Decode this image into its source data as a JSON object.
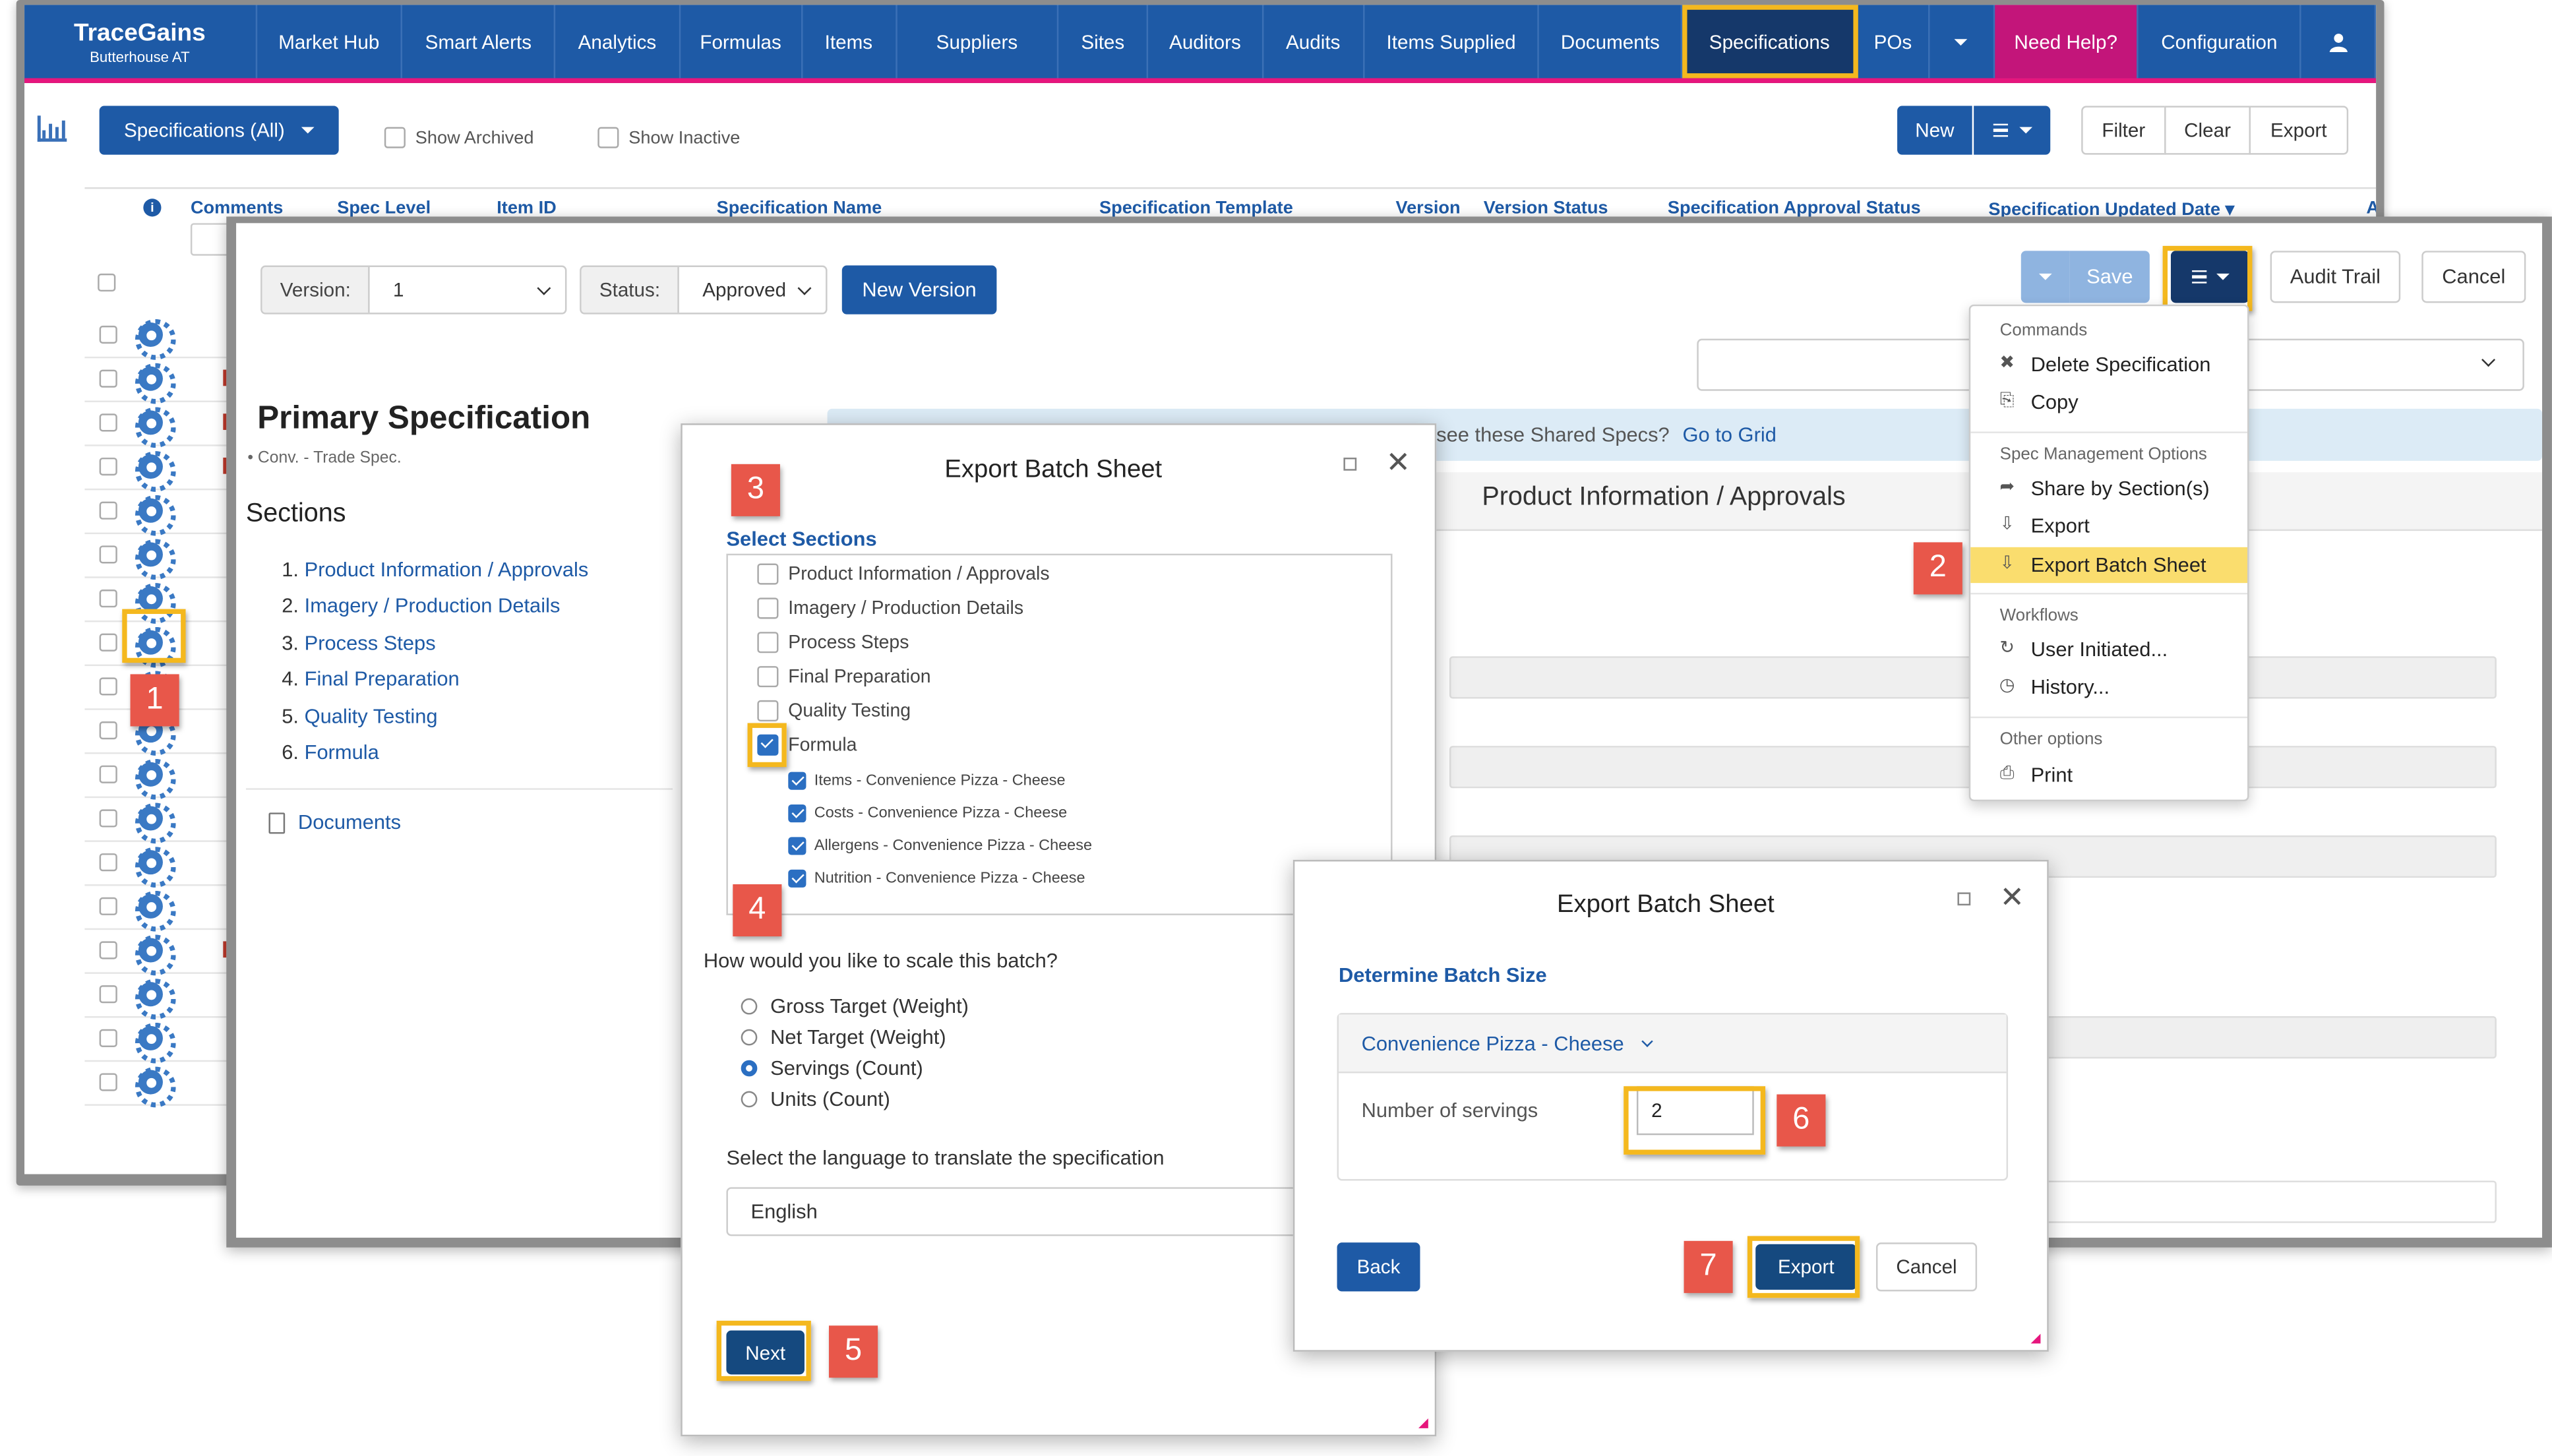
{
  "app": {
    "brand_name": "TraceGains",
    "brand_sub": "Butterhouse AT",
    "nav": [
      "Market Hub",
      "Smart Alerts",
      "Analytics",
      "Formulas",
      "Items",
      "Suppliers",
      "Sites",
      "Auditors",
      "Audits",
      "Items Supplied",
      "Documents",
      "Specifications",
      "POs"
    ],
    "help": "Need Help?",
    "config": "Configuration"
  },
  "list_toolbar": {
    "spec_filter": "Specifications (All)",
    "show_archived": "Show Archived",
    "show_inactive": "Show Inactive",
    "new_label": "New",
    "filter_label": "Filter",
    "clear_label": "Clear",
    "export_label": "Export"
  },
  "grid": {
    "columns": [
      "Comments",
      "Spec Level",
      "Item ID",
      "Specification Name",
      "Specification Template",
      "Version",
      "Version Status",
      "Specification Approval Status",
      "Specification Updated Date ▾",
      "A"
    ]
  },
  "spec_editor": {
    "version_label": "Version:",
    "version_value": "1",
    "status_label": "Status:",
    "status_value": "Approved",
    "new_version": "New Version",
    "save": "Save",
    "audit_trail": "Audit Trail",
    "cancel": "Cancel",
    "primary_title": "Primary Specification",
    "primary_sub": "• Conv. - Trade Spec.",
    "sections_heading": "Sections",
    "sections": [
      {
        "num": "1.",
        "label": "Product Information / Approvals"
      },
      {
        "num": "2.",
        "label": "Imagery / Production Details"
      },
      {
        "num": "3.",
        "label": "Process Steps"
      },
      {
        "num": "4.",
        "label": "Final Preparation"
      },
      {
        "num": "5.",
        "label": "Quality Testing"
      },
      {
        "num": "6.",
        "label": "Formula"
      }
    ],
    "documents": "Documents",
    "shared_banner_text": "see these Shared Specs?",
    "shared_banner_link": "Go to Grid",
    "panel_title": "Product Information / Approvals"
  },
  "dropdown_menu": {
    "commands_header": "Commands",
    "delete_spec": "Delete Specification",
    "copy": "Copy",
    "spec_mgmt_header": "Spec Management Options",
    "share_by_section": "Share by Section(s)",
    "export": "Export",
    "export_batch_sheet": "Export Batch Sheet",
    "workflows_header": "Workflows",
    "user_initiated": "User Initiated...",
    "history": "History...",
    "other_header": "Other options",
    "print": "Print"
  },
  "modal_select": {
    "title": "Export Batch Sheet",
    "select_sections": "Select Sections",
    "sections": [
      "Product Information / Approvals",
      "Imagery / Production Details",
      "Process Steps",
      "Final Preparation",
      "Quality Testing",
      "Formula"
    ],
    "sub_items": [
      "Items - Convenience Pizza - Cheese",
      "Costs - Convenience Pizza - Cheese",
      "Allergens - Convenience Pizza - Cheese",
      "Nutrition - Convenience Pizza - Cheese"
    ],
    "scale_question": "How would you like to scale this batch?",
    "scale_options": [
      "Gross Target (Weight)",
      "Net Target (Weight)",
      "Servings (Count)",
      "Units (Count)"
    ],
    "selected_scale": "Servings (Count)",
    "language_question": "Select the language to translate the specification",
    "language_value": "English",
    "next": "Next"
  },
  "modal_batch": {
    "title": "Export Batch Sheet",
    "determine_batch": "Determine Batch Size",
    "item_name": "Convenience Pizza - Cheese",
    "servings_label": "Number of servings",
    "servings_value": "2",
    "back": "Back",
    "export": "Export",
    "cancel": "Cancel"
  },
  "callouts": [
    "1",
    "2",
    "3",
    "4",
    "5",
    "6",
    "7"
  ],
  "colors": {
    "nav_blue": "#1e5aa6",
    "accent_pink": "#e6167d",
    "highlight_yellow": "#f4b81e",
    "callout_red": "#e8574a",
    "menu_highlight": "#fadd6e"
  }
}
